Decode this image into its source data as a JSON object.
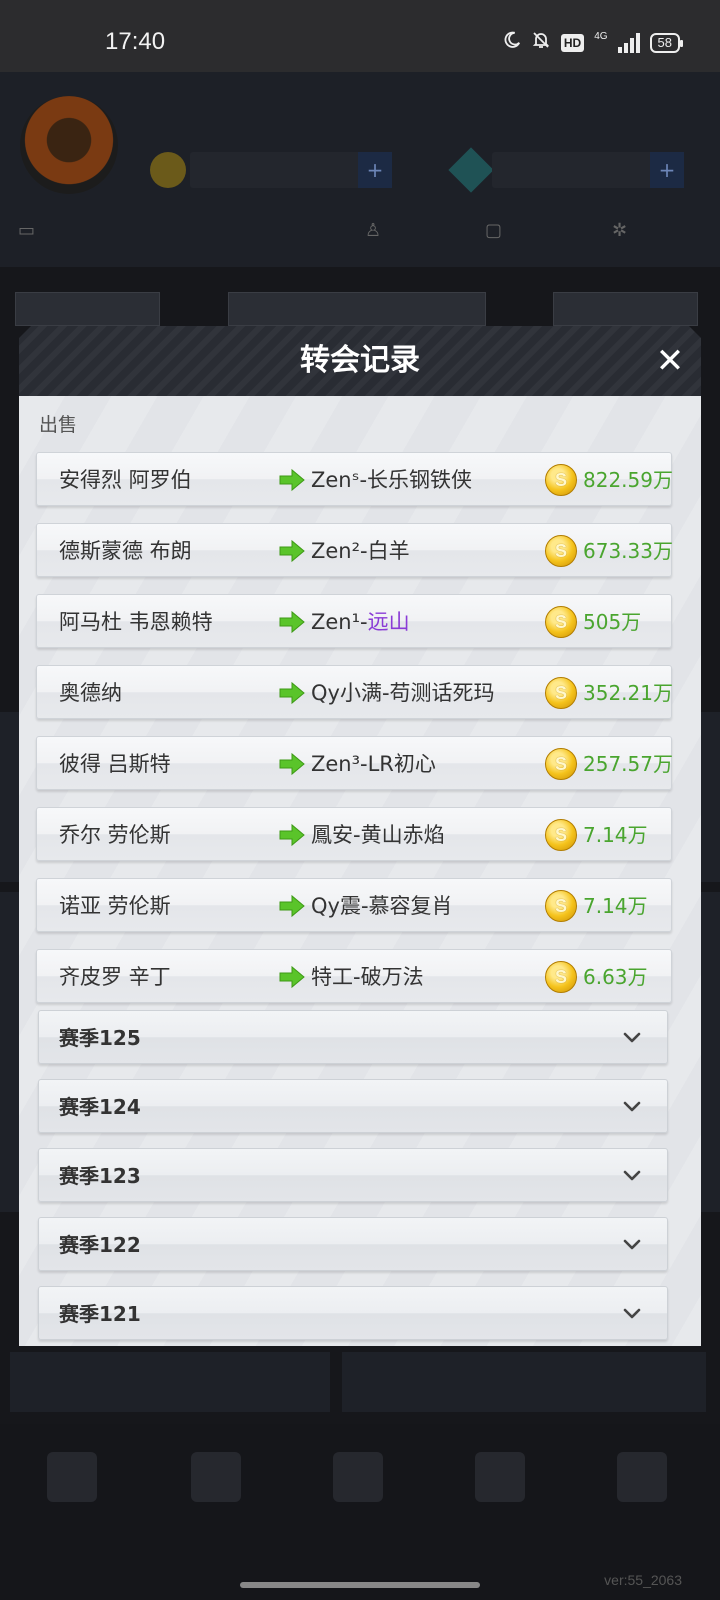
{
  "status_bar": {
    "time": "17:40",
    "network": "4G",
    "hd": "HD",
    "battery": "58",
    "icons": [
      "moon-icon",
      "bell-off-icon",
      "hd-icon",
      "signal-icon",
      "battery-icon"
    ]
  },
  "modal": {
    "title": "转会记录",
    "close_icon": "close-icon",
    "section_label": "出售",
    "sales": [
      {
        "player": "安得烈 阿罗伯",
        "dest": "Zenˢ-长乐钢铁侠",
        "dest_highlight": "",
        "price": "822.59万"
      },
      {
        "player": "德斯蒙德 布朗",
        "dest": "Zen²-白羊",
        "dest_highlight": "",
        "price": "673.33万"
      },
      {
        "player": "阿马杜 韦恩赖特",
        "dest": "Zen¹-",
        "dest_highlight": "远山",
        "price": "505万"
      },
      {
        "player": "奥德纳",
        "dest": "Qy小满-苟测话死玛",
        "dest_highlight": "",
        "price": "352.21万"
      },
      {
        "player": "彼得 吕斯特",
        "dest": "Zen³-LR初心",
        "dest_highlight": "",
        "price": "257.57万"
      },
      {
        "player": "乔尔 劳伦斯",
        "dest": "鳳安-黄山赤焰",
        "dest_highlight": "",
        "price": "7.14万"
      },
      {
        "player": "诺亚 劳伦斯",
        "dest": "Qy震-慕容复肖",
        "dest_highlight": "",
        "price": "7.14万"
      },
      {
        "player": "齐皮罗 辛丁",
        "dest": "特工-破万法",
        "dest_highlight": "",
        "price": "6.63万"
      }
    ],
    "seasons": [
      {
        "label": "赛季125"
      },
      {
        "label": "赛季124"
      },
      {
        "label": "赛季123"
      },
      {
        "label": "赛季122"
      },
      {
        "label": "赛季121"
      }
    ]
  },
  "colors": {
    "price_green": "#4aa52f",
    "highlight_purple": "#8a3bd6",
    "header_dark": "#292c33"
  },
  "version": "ver:55_2063"
}
